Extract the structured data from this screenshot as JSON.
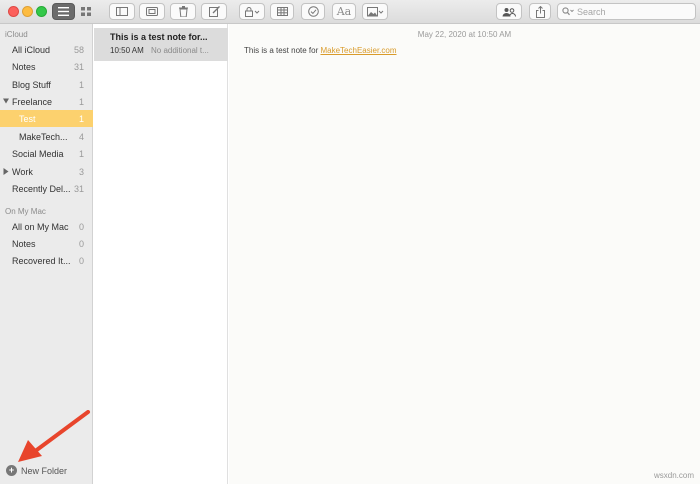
{
  "search": {
    "placeholder": "Search"
  },
  "toolbar": {
    "format_text_glyph": "Aa"
  },
  "sidebar": {
    "icloud_header": "iCloud",
    "on_my_mac_header": "On My Mac",
    "icloud_folders": [
      {
        "name": "All iCloud",
        "count": "58"
      },
      {
        "name": "Notes",
        "count": "31"
      },
      {
        "name": "Blog Stuff",
        "count": "1"
      },
      {
        "name": "Freelance",
        "count": "1"
      },
      {
        "name": "Test",
        "count": "1"
      },
      {
        "name": "MakeTech...",
        "count": "4"
      },
      {
        "name": "Social Media",
        "count": "1"
      },
      {
        "name": "Work",
        "count": "3"
      },
      {
        "name": "Recently Del...",
        "count": "31"
      }
    ],
    "mac_folders": [
      {
        "name": "All on My Mac",
        "count": "0"
      },
      {
        "name": "Notes",
        "count": "0"
      },
      {
        "name": "Recovered It...",
        "count": "0"
      }
    ],
    "new_folder_label": "New Folder"
  },
  "notes": [
    {
      "title": "This is a test note for...",
      "time": "10:50 AM",
      "snippet": "No additional t..."
    }
  ],
  "editor": {
    "date": "May 22, 2020 at 10:50 AM",
    "body_prefix": "This is a test note for ",
    "link_text": "MakeTechEasier.com"
  },
  "watermark": "wsxdn.com",
  "colors": {
    "selected_folder": "#fcd16e",
    "link": "#d99b2b",
    "arrow": "#e8452c"
  }
}
